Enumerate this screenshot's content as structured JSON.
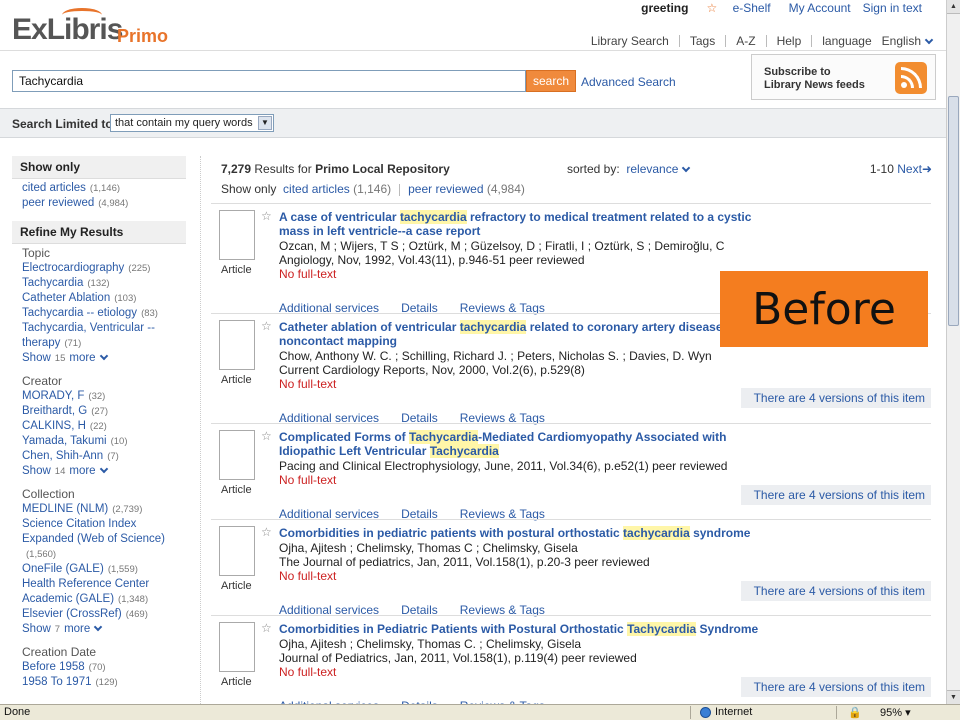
{
  "header": {
    "logo_main": "ExLibris",
    "logo_sub": "Primo",
    "greeting": "greeting",
    "eshelf": "e-Shelf",
    "my_account": "My Account",
    "sign_in": "Sign in text",
    "nav": [
      "Library Search",
      "Tags",
      "A-Z",
      "Help",
      "language"
    ],
    "language_value": "English"
  },
  "search": {
    "query": "Tachycardia",
    "button": "search",
    "advanced": "Advanced Search",
    "limited_label": "Search Limited to:",
    "limited_value": "that contain my query words"
  },
  "rss": {
    "text_line1": "Subscribe to",
    "text_line2": "Library News feeds"
  },
  "sidebar": {
    "show_only_title": "Show only",
    "show_only": [
      {
        "label": "cited articles",
        "count": "(1,146)"
      },
      {
        "label": "peer reviewed",
        "count": "(4,984)"
      }
    ],
    "refine_title": "Refine My Results",
    "topic": {
      "title": "Topic",
      "items": [
        {
          "label": "Electrocardiography",
          "count": "(225)"
        },
        {
          "label": "Tachycardia",
          "count": "(132)"
        },
        {
          "label": "Catheter Ablation",
          "count": "(103)"
        },
        {
          "label": "Tachycardia -- etiology",
          "count": "(83)"
        },
        {
          "label": "Tachycardia, Ventricular -- therapy",
          "count": "(71)"
        }
      ],
      "show": "Show",
      "show_num": "15",
      "more": "more"
    },
    "creator": {
      "title": "Creator",
      "items": [
        {
          "label": "MORADY, F",
          "count": "(32)"
        },
        {
          "label": "Breithardt, G",
          "count": "(27)"
        },
        {
          "label": "CALKINS, H",
          "count": "(22)"
        },
        {
          "label": "Yamada, Takumi",
          "count": "(10)"
        },
        {
          "label": "Chen, Shih-Ann",
          "count": "(7)"
        }
      ],
      "show": "Show",
      "show_num": "14",
      "more": "more"
    },
    "collection": {
      "title": "Collection",
      "items": [
        {
          "label": "MEDLINE (NLM)",
          "count": "(2,739)"
        },
        {
          "label": "Science Citation Index Expanded (Web of Science)",
          "count": "(1,560)"
        },
        {
          "label": "OneFile (GALE)",
          "count": "(1,559)"
        },
        {
          "label": "Health Reference Center Academic (GALE)",
          "count": "(1,348)"
        },
        {
          "label": "Elsevier (CrossRef)",
          "count": "(469)"
        }
      ],
      "show": "Show",
      "show_num": "7",
      "more": "more"
    },
    "creation_date": {
      "title": "Creation Date",
      "items": [
        {
          "label": "Before 1958",
          "count": "(70)"
        },
        {
          "label": "1958 To 1971",
          "count": "(129)"
        }
      ]
    }
  },
  "results": {
    "count": "7,279",
    "results_for": "Results for",
    "repository": "Primo Local Repository",
    "sorted_by": "sorted by:",
    "sort_value": "relevance",
    "pager": "1-10",
    "next": "Next",
    "show_only": "Show only",
    "filter1": "cited articles",
    "filter1_count": "(1,146)",
    "filter2": "peer reviewed",
    "filter2_count": "(4,984)",
    "type_label": "Article",
    "no_fulltext": "No full-text",
    "act_additional": "Additional services",
    "act_details": "Details",
    "act_reviews": "Reviews & Tags",
    "versions": "There are 4 versions of this item",
    "items": [
      {
        "t1": "A case of ventricular ",
        "t2": "tachycardia",
        "t3": " refractory to medical treatment related to a cystic mass in left ventricle--a case report",
        "t4": "",
        "t5": "",
        "authors": "Ozcan, M ; Wijers, T S ; Oztürk, M ; Güzelsoy, D ; Firatli, I ; Oztürk, S ; Demiroğlu, C",
        "source": "Angiology, Nov, 1992, Vol.43(11), p.946-51 peer reviewed"
      },
      {
        "t1": "Catheter ablation of ventricular ",
        "t2": "tachycardia",
        "t3": " related to coronary artery disease: The noncontact mapping",
        "t4": "",
        "t5": "",
        "authors": "Chow, Anthony W. C. ; Schilling, Richard J. ; Peters, Nicholas S. ; Davies, D. Wyn",
        "source": "Current Cardiology Reports, Nov, 2000, Vol.2(6), p.529(8)"
      },
      {
        "t1": "Complicated Forms of ",
        "t2": "Tachycardia",
        "t3": "-Mediated Cardiomyopathy Associated with Idiopathic Left Ventricular ",
        "t4": "Tachycardia",
        "t5": "",
        "authors": "",
        "source": "Pacing and Clinical Electrophysiology, June, 2011, Vol.34(6), p.e52(1) peer reviewed"
      },
      {
        "t1": "Comorbidities in pediatric patients with postural orthostatic ",
        "t2": "tachycardia",
        "t3": " syndrome",
        "t4": "",
        "t5": "",
        "authors": "Ojha, Ajitesh ; Chelimsky, Thomas C ; Chelimsky, Gisela",
        "source": "The Journal of pediatrics, Jan, 2011, Vol.158(1), p.20-3 peer reviewed"
      },
      {
        "t1": "Comorbidities in Pediatric Patients with Postural Orthostatic ",
        "t2": "Tachycardia",
        "t3": " Syndrome",
        "t4": "",
        "t5": "",
        "authors": "Ojha, Ajitesh ; Chelimsky, Thomas C. ; Chelimsky, Gisela",
        "source": "Journal of Pediatrics, Jan, 2011, Vol.158(1), p.119(4) peer reviewed"
      }
    ]
  },
  "overlay": {
    "before": "Before"
  },
  "status": {
    "text": "Done",
    "zone": "Internet",
    "zoom": "95%"
  },
  "colors": {
    "accent": "#f08a3c",
    "link": "#2b5aa6",
    "nofull": "#cc2222",
    "highlight": "#fff6a8"
  }
}
